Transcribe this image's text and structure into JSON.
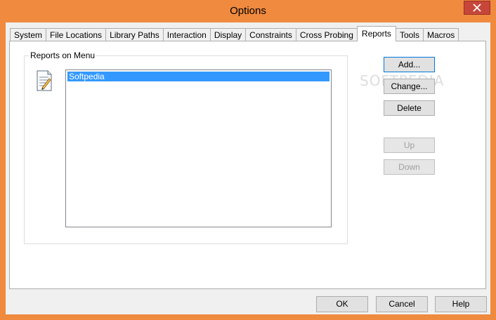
{
  "window": {
    "title": "Options"
  },
  "tabs": [
    {
      "label": "System"
    },
    {
      "label": "File Locations"
    },
    {
      "label": "Library Paths"
    },
    {
      "label": "Interaction"
    },
    {
      "label": "Display"
    },
    {
      "label": "Constraints"
    },
    {
      "label": "Cross Probing"
    },
    {
      "label": "Reports"
    },
    {
      "label": "Tools"
    },
    {
      "label": "Macros"
    }
  ],
  "active_tab": "Reports",
  "reports_group": {
    "label": "Reports on Menu",
    "icon": "report-document-icon",
    "items": [
      {
        "label": "Softpedia",
        "selected": true
      }
    ]
  },
  "side_buttons": {
    "add": "Add...",
    "change": "Change...",
    "delete": "Delete",
    "up": "Up",
    "down": "Down"
  },
  "bottom_buttons": {
    "ok": "OK",
    "cancel": "Cancel",
    "help": "Help"
  },
  "watermark": "SOFTPEDIA",
  "colors": {
    "titlebar": "#ef8a3f",
    "selection": "#3399ff",
    "close_button": "#c7463a"
  }
}
